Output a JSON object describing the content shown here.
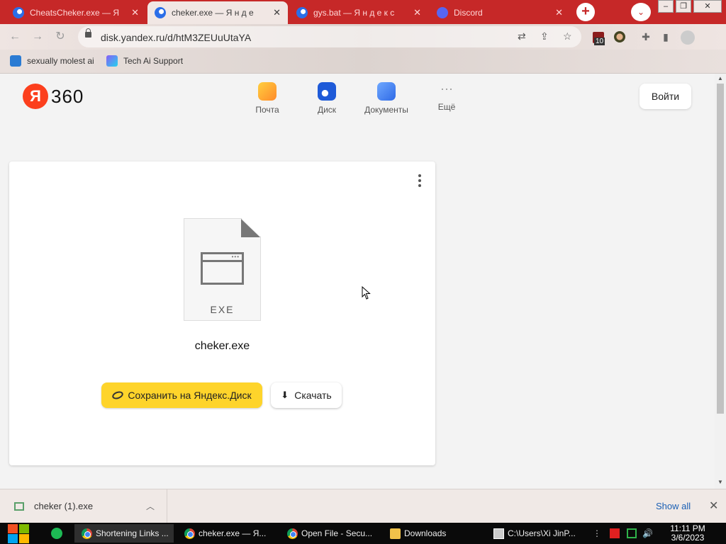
{
  "browser": {
    "tabs": [
      {
        "title": "CheatsCheker.exe — Я",
        "favicon": "yandex-disk-icon",
        "active": false
      },
      {
        "title": "cheker.exe — Я н д е",
        "favicon": "yandex-disk-icon",
        "active": true
      },
      {
        "title": "gys.bat — Я н д е к с",
        "favicon": "yandex-disk-icon",
        "active": false
      },
      {
        "title": "Discord",
        "favicon": "discord-icon",
        "active": false
      }
    ],
    "tab_close_glyph": "✕",
    "new_tab_glyph": "+",
    "tab_menu_glyph": "⌄",
    "url": "disk.yandex.ru/d/htM3ZEUuUtaYA",
    "extension_badge_count": "10",
    "bookmarks": [
      {
        "label": "sexually molest ai"
      },
      {
        "label": "Tech Ai Support"
      }
    ],
    "accent_color": "#c62828"
  },
  "page": {
    "logo_letter": "Я",
    "logo_number": "360",
    "services": [
      {
        "label": "Почта",
        "icon": "mail-icon"
      },
      {
        "label": "Диск",
        "icon": "disk-icon"
      },
      {
        "label": "Документы",
        "icon": "documents-icon"
      },
      {
        "label": "Ещё",
        "icon": "more-icon"
      }
    ],
    "more_glyph": "···",
    "login_label": "Войти",
    "file": {
      "extension": "EXE",
      "name": "cheker.exe"
    },
    "save_button_label": "Сохранить на Яндекс.Диск",
    "download_button_label": "Скачать",
    "save_button_color": "#fed42b"
  },
  "download_shelf": {
    "item_name": "cheker (1).exe",
    "show_all_label": "Show all"
  },
  "taskbar": {
    "windows": [
      {
        "label": "Shortening Links ...",
        "icon": "chrome-icon",
        "active": true
      },
      {
        "label": "cheker.exe — Я...",
        "icon": "chrome-icon",
        "active": false
      },
      {
        "label": "Open File - Secu...",
        "icon": "chrome-icon",
        "active": false
      },
      {
        "label": "Downloads",
        "icon": "folder-icon",
        "active": false
      },
      {
        "label": "C:\\Users\\Xi JinP...",
        "icon": "cmd-icon",
        "active": false
      }
    ],
    "time": "11:11 PM",
    "date": "3/6/2023"
  }
}
